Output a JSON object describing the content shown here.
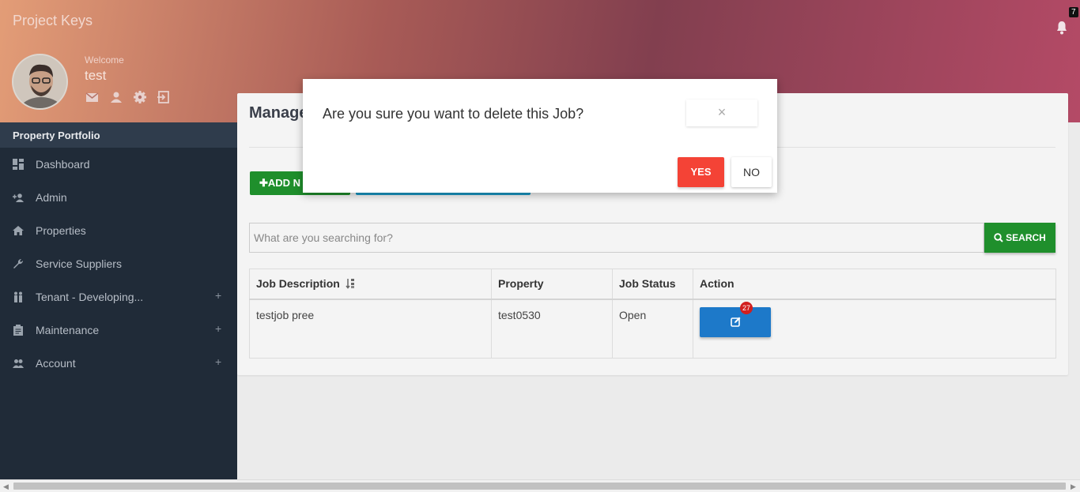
{
  "app": {
    "title": "Project Keys"
  },
  "notifications": {
    "count": "7"
  },
  "user": {
    "welcome": "Welcome",
    "name": "test"
  },
  "sidebar": {
    "header": "Property Portfolio",
    "items": [
      {
        "label": "Dashboard",
        "icon": "dashboard-icon",
        "expandable": false
      },
      {
        "label": "Admin",
        "icon": "add-user-icon",
        "expandable": false
      },
      {
        "label": "Properties",
        "icon": "home-icon",
        "expandable": false
      },
      {
        "label": "Service Suppliers",
        "icon": "wrench-icon",
        "expandable": false
      },
      {
        "label": "Tenant - Developing...",
        "icon": "people-icon",
        "expandable": true,
        "toggle": "+"
      },
      {
        "label": "Maintenance",
        "icon": "clipboard-icon",
        "expandable": true,
        "toggle": "+"
      },
      {
        "label": "Account",
        "icon": "group-icon",
        "expandable": true,
        "toggle": "+"
      }
    ]
  },
  "panel": {
    "title": "Manage",
    "add_button": "✚ADD N",
    "search_placeholder": "What are you searching for?",
    "search_button": "SEARCH"
  },
  "table": {
    "headers": [
      "Job Description",
      "Property",
      "Job Status",
      "Action"
    ],
    "rows": [
      {
        "description": "testjob pree",
        "property": "test0530",
        "status": "Open",
        "badge": "27"
      }
    ]
  },
  "modal": {
    "message": "Are you sure you want to delete this Job?",
    "close": "×",
    "yes": "YES",
    "no": "NO"
  },
  "colors": {
    "sidebar": "#202b38",
    "primary_green": "#1f8f2c",
    "yes_red": "#f44336",
    "edit_blue": "#1d79c9"
  }
}
